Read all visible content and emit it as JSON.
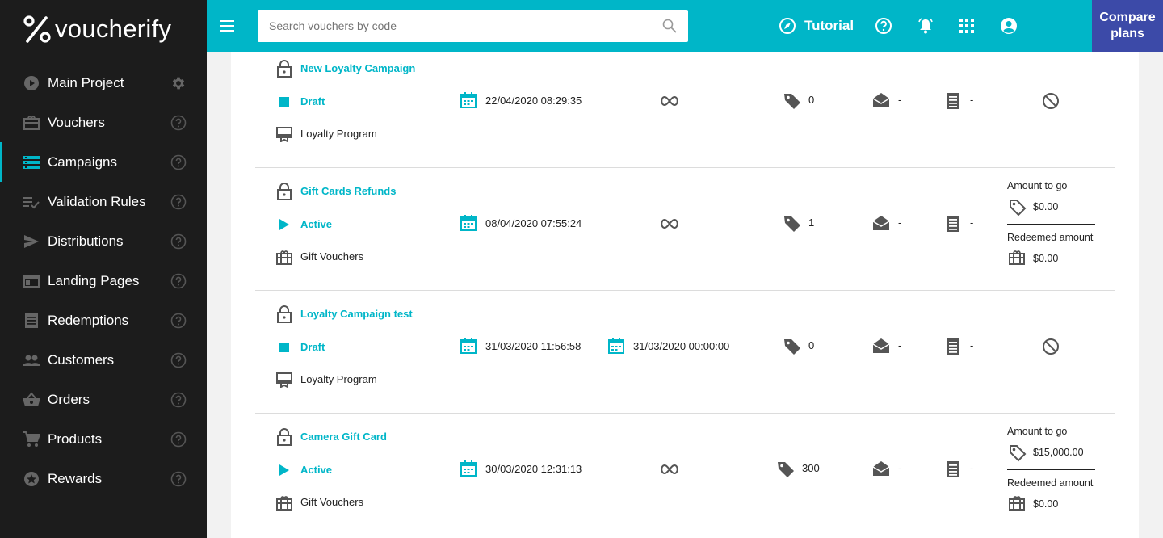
{
  "brand": {
    "name": "voucherify",
    "accent": "#00b6c8",
    "sidebar_bg": "#1c1c1c",
    "compare_bg": "#3c4aa8"
  },
  "sidebar": {
    "items": [
      {
        "label": "Main Project",
        "icon": "play-circle-icon",
        "right": "gear-icon"
      },
      {
        "label": "Vouchers",
        "icon": "gift-card-icon",
        "right": "help-icon"
      },
      {
        "label": "Campaigns",
        "icon": "list-icon",
        "right": "help-icon",
        "active": true
      },
      {
        "label": "Validation Rules",
        "icon": "checklist-icon",
        "right": "help-icon"
      },
      {
        "label": "Distributions",
        "icon": "send-icon",
        "right": "help-icon"
      },
      {
        "label": "Landing Pages",
        "icon": "web-page-icon",
        "right": "help-icon"
      },
      {
        "label": "Redemptions",
        "icon": "receipt-icon",
        "right": "help-icon"
      },
      {
        "label": "Customers",
        "icon": "people-icon",
        "right": "help-icon"
      },
      {
        "label": "Orders",
        "icon": "basket-icon",
        "right": "help-icon"
      },
      {
        "label": "Products",
        "icon": "cart-icon",
        "right": "help-icon"
      },
      {
        "label": "Rewards",
        "icon": "star-icon",
        "right": "help-icon"
      }
    ]
  },
  "topbar": {
    "search_placeholder": "Search vouchers by code",
    "tutorial_label": "Tutorial",
    "compare_label_1": "Compare",
    "compare_label_2": "plans"
  },
  "campaigns": [
    {
      "name": "New Loyalty Campaign",
      "status": "Draft",
      "type": "Loyalty Program",
      "start": "22/04/2020 08:29:35",
      "end": null,
      "vouchers": "0",
      "distributions": "-",
      "redemptions": "-"
    },
    {
      "name": "Gift Cards Refunds",
      "status": "Active",
      "type": "Gift Vouchers",
      "start": "08/04/2020 07:55:24",
      "end": null,
      "vouchers": "1",
      "distributions": "-",
      "redemptions": "-",
      "amount_to_go_label": "Amount to go",
      "amount_to_go": "$0.00",
      "redeemed_label": "Redeemed amount",
      "redeemed": "$0.00"
    },
    {
      "name": "Loyalty Campaign test",
      "status": "Draft",
      "type": "Loyalty Program",
      "start": "31/03/2020 11:56:58",
      "end": "31/03/2020 00:00:00",
      "vouchers": "0",
      "distributions": "-",
      "redemptions": "-"
    },
    {
      "name": "Camera Gift Card",
      "status": "Active",
      "type": "Gift Vouchers",
      "start": "30/03/2020 12:31:13",
      "end": null,
      "vouchers": "300",
      "distributions": "-",
      "redemptions": "-",
      "amount_to_go_label": "Amount to go",
      "amount_to_go": "$15,000.00",
      "redeemed_label": "Redeemed amount",
      "redeemed": "$0.00"
    }
  ]
}
